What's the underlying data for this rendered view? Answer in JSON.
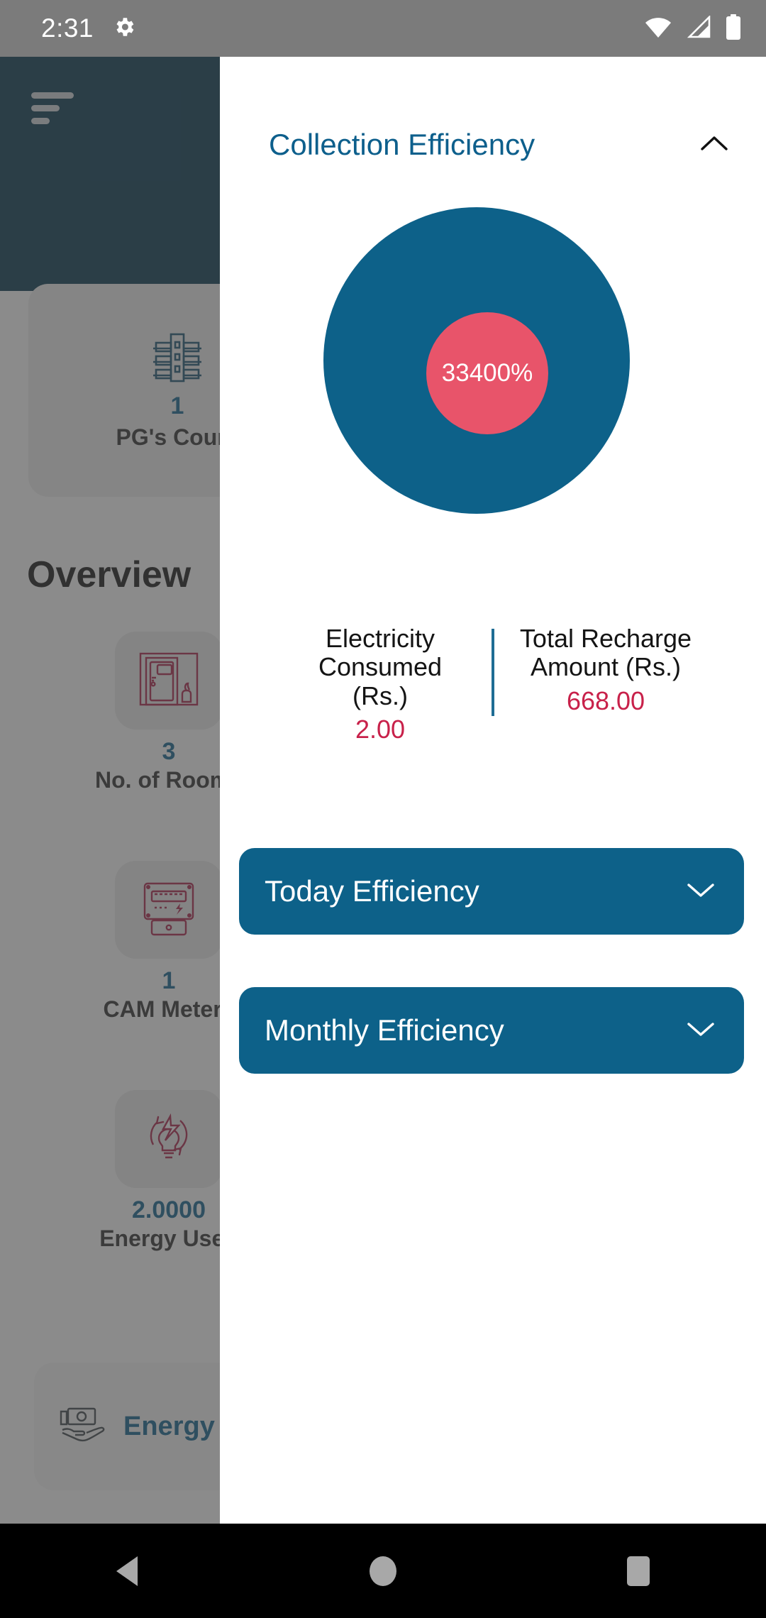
{
  "status_bar": {
    "clock": "2:31",
    "icons": [
      "gear-icon",
      "wifi-icon",
      "cellular-signal-icon",
      "battery-icon"
    ]
  },
  "background": {
    "appbar": {
      "menu_icon": "hamburger-menu-icon"
    },
    "top_card": {
      "value": "1",
      "label": "PG's Count",
      "icon": "building-icon"
    },
    "overview_title": "Overview",
    "stats": [
      {
        "value": "3",
        "label": "No. of Rooms",
        "icon": "door-room-icon"
      },
      {
        "value": "1",
        "label": "CAM Meters",
        "icon": "electric-meter-icon"
      },
      {
        "value": "2.0000",
        "label": "Energy Used",
        "icon": "energy-bulb-icon"
      }
    ],
    "energy_card": {
      "label": "Energy u",
      "icon": "money-hand-icon"
    }
  },
  "sheet": {
    "title": "Collection Efficiency",
    "collapse_icon": "chevron-up-icon",
    "kpis": [
      {
        "label": "Electricity Consumed (Rs.)",
        "value": "2.00"
      },
      {
        "label": "Total Recharge Amount (Rs.)",
        "value": "668.00"
      }
    ],
    "buttons": [
      {
        "label": "Today Efficiency",
        "icon": "chevron-down-icon"
      },
      {
        "label": "Monthly Efficiency",
        "icon": "chevron-down-icon"
      }
    ]
  },
  "nav_bar": {
    "back": "back-triangle-icon",
    "home": "home-circle-icon",
    "recents": "recents-square-icon"
  },
  "colors": {
    "brand_blue": "#0d6189",
    "title_blue": "#0d5f8c",
    "appbar_navy": "#00324b",
    "accent_pink": "#e8546a",
    "crimson": "#c8214a",
    "scrim": "rgba(70,70,70,0.62)"
  },
  "chart_data": {
    "type": "pie",
    "title": "Collection Efficiency",
    "categories": [
      "Collection Efficiency"
    ],
    "values": [
      33400
    ],
    "value_label": "33400%",
    "unit": "%",
    "colors": [
      "#0d6189",
      "#e8546a"
    ],
    "center_label": "33400%",
    "legend": [],
    "annotations": [
      {
        "label": "Electricity Consumed (Rs.)",
        "value": 2.0
      },
      {
        "label": "Total Recharge Amount (Rs.)",
        "value": 668.0
      }
    ]
  }
}
